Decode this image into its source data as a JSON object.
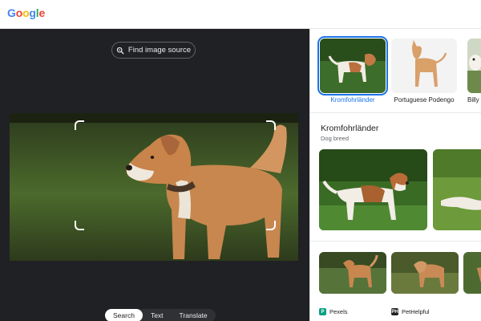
{
  "header": {
    "logo_letters": [
      "G",
      "o",
      "o",
      "g",
      "l",
      "e"
    ],
    "logo_colors": [
      "#4285F4",
      "#EA4335",
      "#FBBC05",
      "#4285F4",
      "#34A853",
      "#EA4335"
    ]
  },
  "lens": {
    "find_source_label": "Find image source",
    "find_source_icon": "lens-search-icon",
    "modes": [
      {
        "label": "Search",
        "active": true
      },
      {
        "label": "Text",
        "active": false
      },
      {
        "label": "Translate",
        "active": false
      }
    ]
  },
  "results": {
    "visual_matches": [
      {
        "label": "Kromfohrländer",
        "selected": true
      },
      {
        "label": "Portuguese Podengo",
        "selected": false
      },
      {
        "label": "Billy",
        "selected": false
      }
    ],
    "entity": {
      "title": "Kromfohrländer",
      "subtitle": "Dog breed"
    },
    "sources": [
      {
        "name": "Pexels",
        "icon": "pexels-icon",
        "color": "#05a081"
      },
      {
        "name": "PetHelpful",
        "icon": "pethelpful-icon",
        "color": "#202124"
      }
    ]
  },
  "colors": {
    "accent": "#1a73e8",
    "dark_bg": "#202124"
  }
}
